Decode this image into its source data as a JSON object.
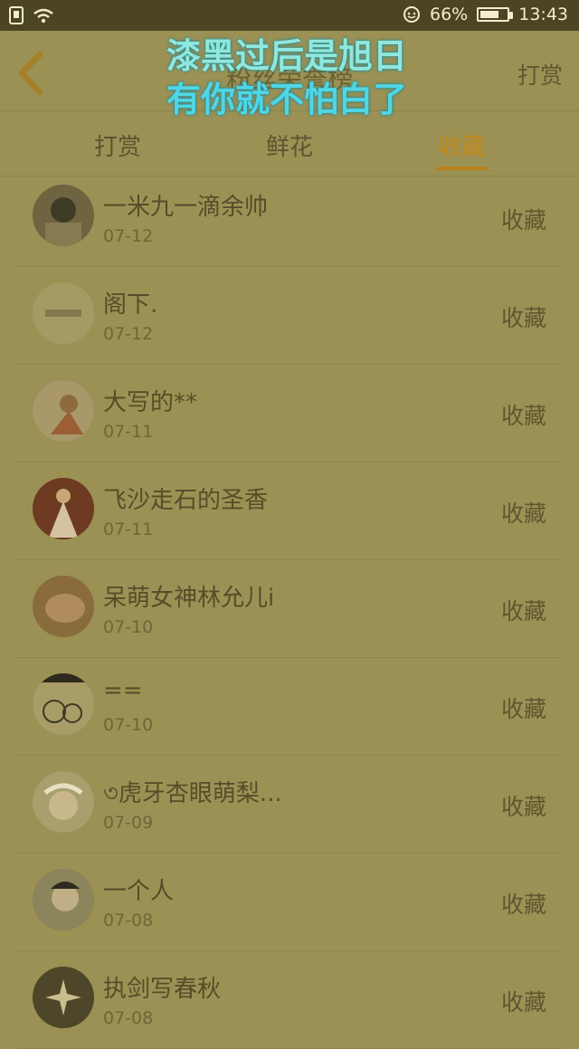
{
  "status": {
    "battery": "66%",
    "time": "13:43"
  },
  "header": {
    "title": "粉丝荣誉榜",
    "right_button": "打赏"
  },
  "overlay": {
    "line1": "漆黑过后是旭日",
    "line2": "有你就不怕白了"
  },
  "tabs": [
    {
      "label": "打赏"
    },
    {
      "label": "鲜花"
    },
    {
      "label": "收藏"
    }
  ],
  "active_tab": 2,
  "rows": [
    {
      "name": "一米九一滴余帅",
      "date": "07-12",
      "action": "收藏"
    },
    {
      "name": "阁下.",
      "date": "07-12",
      "action": "收藏"
    },
    {
      "name": "大写的**",
      "date": "07-11",
      "action": "收藏"
    },
    {
      "name": "飞沙走石的圣香",
      "date": "07-11",
      "action": "收藏"
    },
    {
      "name": "呆萌女神林允儿i",
      "date": "07-10",
      "action": "收藏"
    },
    {
      "name": "==",
      "date": "07-10",
      "action": "收藏"
    },
    {
      "name": "৩虎牙杏眼萌梨...",
      "date": "07-09",
      "action": "收藏"
    },
    {
      "name": "一个人",
      "date": "07-08",
      "action": "收藏"
    },
    {
      "name": "执剑写春秋",
      "date": "07-08",
      "action": "收藏"
    }
  ],
  "colors": {
    "background": "#9c9154",
    "accent": "#c38a1b",
    "statusbar": "#4b4523"
  }
}
